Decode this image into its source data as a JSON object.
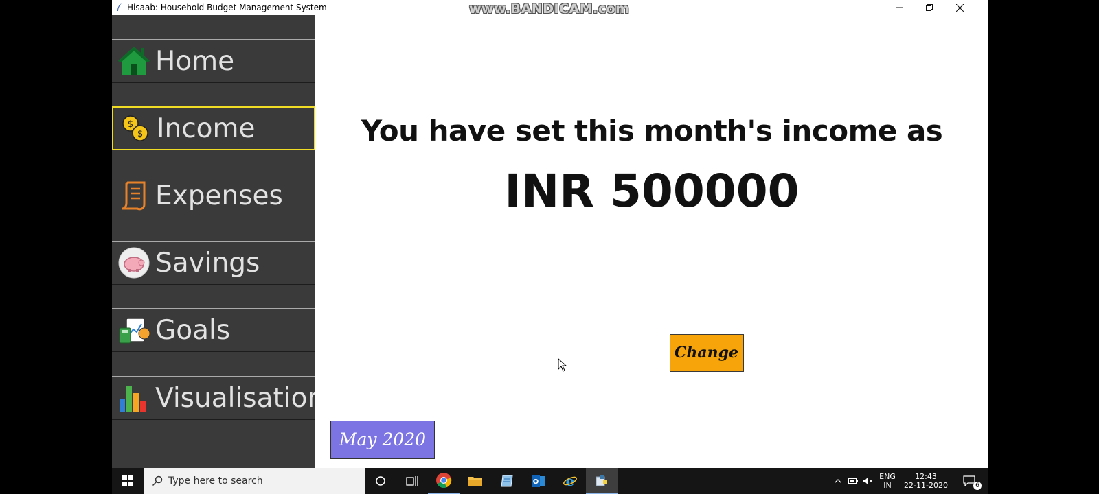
{
  "window": {
    "title": "Hisaab: Household Budget Management System",
    "watermark": "www.BANDICAM.com"
  },
  "sidebar": {
    "items": [
      {
        "label": "Home",
        "icon": "house-icon",
        "active": false
      },
      {
        "label": "Income",
        "icon": "coins-icon",
        "active": true
      },
      {
        "label": "Expenses",
        "icon": "receipt-icon",
        "active": false
      },
      {
        "label": "Savings",
        "icon": "piggy-bank-icon",
        "active": false
      },
      {
        "label": "Goals",
        "icon": "goals-icon",
        "active": false
      },
      {
        "label": "Visualisations",
        "icon": "bar-chart-icon",
        "active": false
      }
    ]
  },
  "main": {
    "heading": "You have set this month's income as",
    "income_value": "INR 500000",
    "change_label": "Change",
    "month_label": "May 2020"
  },
  "colors": {
    "sidebar_bg": "#3a3a3a",
    "active_border": "#f1dc25",
    "change_button": "#f7a30a",
    "month_button": "#7b74e2"
  },
  "taskbar": {
    "search_placeholder": "Type here to search",
    "apps": [
      "cortana-icon",
      "task-view-icon",
      "chrome-icon",
      "file-explorer-icon",
      "notepad-icon",
      "outlook-icon",
      "internet-explorer-icon",
      "python-icon"
    ],
    "language": "ENG",
    "region": "IN",
    "time": "12:43",
    "date": "22-11-2020",
    "notification_count": "6"
  }
}
